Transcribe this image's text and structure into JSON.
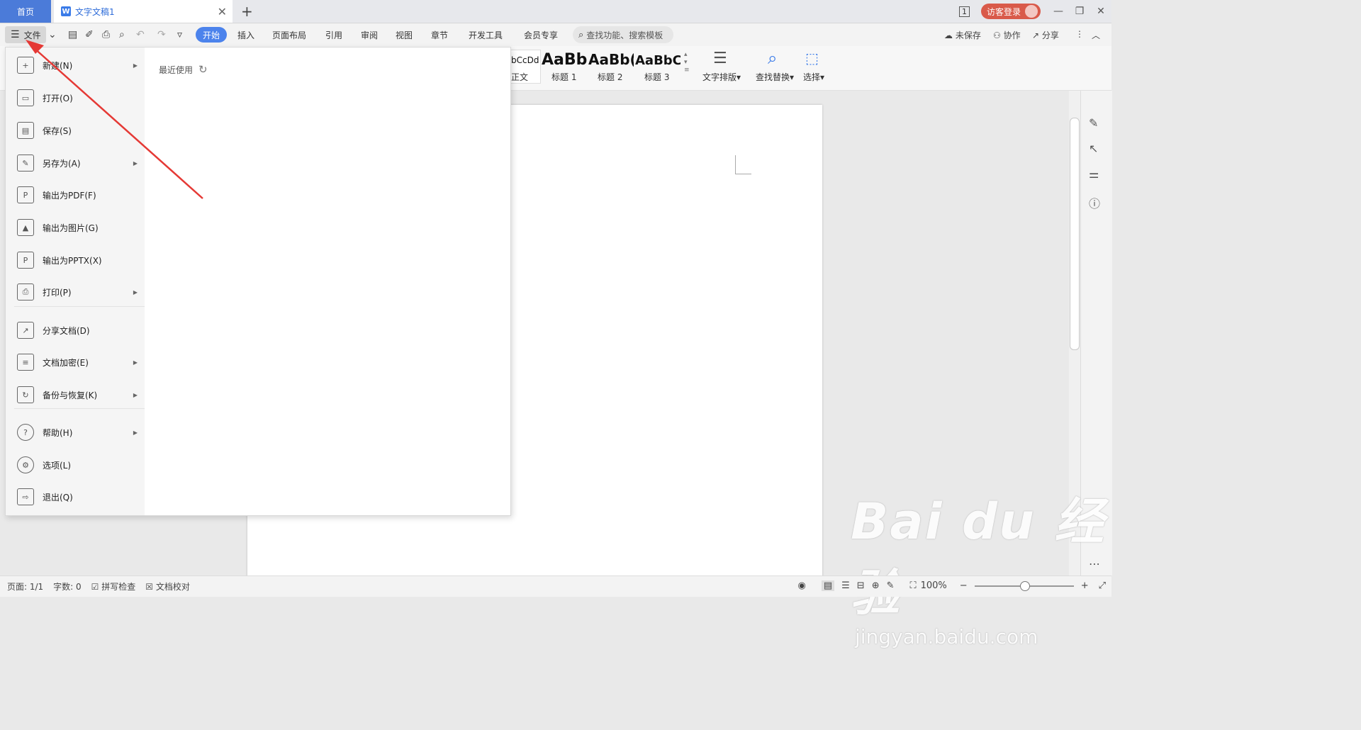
{
  "titlebar": {
    "home_tab": "首页",
    "doc_tab": "文字文稿1",
    "doc_icon": "W",
    "login": "访客登录",
    "page_count_badge": "1"
  },
  "ribbon": {
    "file_label": "文件",
    "tabs": [
      "开始",
      "插入",
      "页面布局",
      "引用",
      "审阅",
      "视图",
      "章节",
      "开发工具",
      "会员专享"
    ],
    "search_placeholder": "查找功能、搜索模板",
    "right": {
      "unsaved": "未保存",
      "collab": "协作",
      "share": "分享"
    }
  },
  "toolbar": {
    "styles": [
      {
        "sample": "bCcDd",
        "caption": "正文"
      },
      {
        "sample": "AaBb",
        "caption": "标题 1"
      },
      {
        "sample": "AaBb(",
        "caption": "标题 2"
      },
      {
        "sample": "AaBbC",
        "caption": "标题 3"
      }
    ],
    "text_layout": "文字排版",
    "find_replace": "查找替换",
    "select": "选择"
  },
  "file_menu": {
    "items": [
      {
        "label": "新建(N)",
        "icon": "new-doc-icon",
        "glyph": "+",
        "submenu": true
      },
      {
        "label": "打开(O)",
        "icon": "folder-open-icon",
        "glyph": "▭",
        "submenu": false
      },
      {
        "label": "保存(S)",
        "icon": "save-icon",
        "glyph": "▤",
        "submenu": false
      },
      {
        "label": "另存为(A)",
        "icon": "save-as-icon",
        "glyph": "✎",
        "submenu": true
      },
      {
        "label": "输出为PDF(F)",
        "icon": "export-pdf-icon",
        "glyph": "P",
        "submenu": false
      },
      {
        "label": "输出为图片(G)",
        "icon": "export-image-icon",
        "glyph": "▲",
        "submenu": false
      },
      {
        "label": "输出为PPTX(X)",
        "icon": "export-pptx-icon",
        "glyph": "P",
        "submenu": false
      },
      {
        "label": "打印(P)",
        "icon": "print-icon",
        "glyph": "⎙",
        "submenu": true
      },
      {
        "label": "分享文档(D)",
        "icon": "share-doc-icon",
        "glyph": "↗",
        "submenu": false
      },
      {
        "label": "文档加密(E)",
        "icon": "encrypt-icon",
        "glyph": "≡",
        "submenu": true
      },
      {
        "label": "备份与恢复(K)",
        "icon": "backup-icon",
        "glyph": "↻",
        "submenu": true
      },
      {
        "label": "帮助(H)",
        "icon": "help-icon",
        "glyph": "?",
        "submenu": true
      },
      {
        "label": "选项(L)",
        "icon": "gear-icon",
        "glyph": "⚙",
        "submenu": false
      },
      {
        "label": "退出(Q)",
        "icon": "exit-icon",
        "glyph": "⇨",
        "submenu": false
      }
    ],
    "recent_label": "最近使用"
  },
  "status": {
    "page": "页面: 1/1",
    "words": "字数: 0",
    "spell": "拼写检查",
    "proof": "文档校对",
    "zoom": "100%",
    "zoom_level": 1.0
  },
  "watermark": {
    "main": "Bai du 经验",
    "sub": "jingyan.baidu.com"
  },
  "colors": {
    "accent": "#4c83ec",
    "home_tab": "#4b7bd9",
    "login": "#d95a4a",
    "annotation": "#e53935"
  }
}
